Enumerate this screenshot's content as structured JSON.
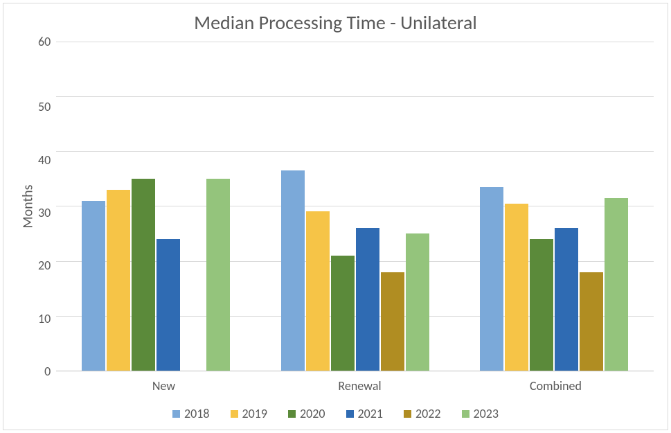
{
  "chart_data": {
    "type": "bar",
    "title": "Median Processing Time - Unilateral",
    "ylabel": "Months",
    "xlabel": "",
    "ylim": [
      0,
      60
    ],
    "yticks": [
      0,
      10,
      20,
      30,
      40,
      50,
      60
    ],
    "categories": [
      "New",
      "Renewal",
      "Combined"
    ],
    "series": [
      {
        "name": "2018",
        "color": "#7ba9d9",
        "values": [
          31,
          36.5,
          33.5
        ]
      },
      {
        "name": "2019",
        "color": "#f6c447",
        "values": [
          33,
          29,
          30.5
        ]
      },
      {
        "name": "2020",
        "color": "#5b8a3a",
        "values": [
          35,
          21,
          24
        ]
      },
      {
        "name": "2021",
        "color": "#2f6bb3",
        "values": [
          24,
          26,
          26
        ]
      },
      {
        "name": "2022",
        "color": "#b08d22",
        "values": [
          0,
          18,
          18
        ]
      },
      {
        "name": "2023",
        "color": "#94c47c",
        "values": [
          35,
          25,
          31.5
        ]
      }
    ],
    "legend_position": "bottom",
    "grid": true
  }
}
